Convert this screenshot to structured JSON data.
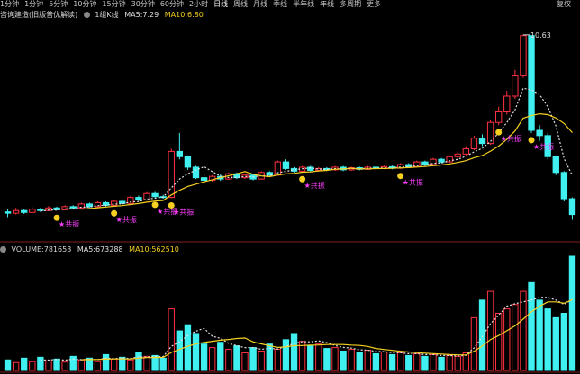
{
  "toolbar": {
    "tabs": [
      "1分钟",
      "1分钟",
      "5分钟",
      "10分钟",
      "15分钟",
      "30分钟",
      "60分钟",
      "2小时",
      "日线",
      "周线",
      "月线",
      "季线",
      "半年线",
      "年线",
      "多周期",
      "更多"
    ],
    "active_index": 8,
    "right_label": "复权"
  },
  "price_panel": {
    "title": "咨询建造(旧版普优解读)",
    "indicator": "1组K线",
    "ma5_label": "MA5:7.29",
    "ma10_label": "MA10:6.80",
    "peak_label": "10.63",
    "signal_label": "共振",
    "colors": {
      "up": "#ff3040",
      "down": "#40f0f0",
      "ma5": "#e0e0e0",
      "ma10": "#f5d020"
    }
  },
  "volume_panel": {
    "volume_label": "VOLUME:781653",
    "ma5_label": "MA5:673288",
    "ma10_label": "MA10:562510"
  },
  "chart_data": {
    "type": "candlestick",
    "price_ylim": [
      3.0,
      11.0
    ],
    "candles": [
      [
        3.9,
        3.85,
        4.0,
        3.7
      ],
      [
        3.85,
        3.95,
        4.05,
        3.8
      ],
      [
        3.95,
        3.88,
        4.0,
        3.82
      ],
      [
        3.88,
        4.0,
        4.08,
        3.85
      ],
      [
        4.0,
        3.95,
        4.05,
        3.9
      ],
      [
        3.95,
        4.05,
        4.12,
        3.92
      ],
      [
        4.05,
        3.98,
        4.1,
        3.95
      ],
      [
        3.98,
        4.1,
        4.15,
        3.96
      ],
      [
        4.1,
        4.05,
        4.15,
        4.0
      ],
      [
        4.05,
        4.2,
        4.25,
        4.02
      ],
      [
        4.2,
        4.1,
        4.25,
        4.05
      ],
      [
        4.1,
        4.25,
        4.3,
        4.08
      ],
      [
        4.25,
        4.15,
        4.3,
        4.1
      ],
      [
        4.15,
        4.3,
        4.35,
        4.12
      ],
      [
        4.3,
        4.22,
        4.36,
        4.18
      ],
      [
        4.22,
        4.45,
        4.5,
        4.2
      ],
      [
        4.45,
        4.35,
        4.52,
        4.3
      ],
      [
        4.35,
        4.6,
        4.65,
        4.32
      ],
      [
        4.6,
        4.48,
        4.66,
        4.44
      ],
      [
        4.48,
        4.45,
        4.55,
        4.4
      ],
      [
        4.45,
        6.2,
        6.3,
        4.42
      ],
      [
        6.2,
        6.0,
        6.9,
        5.9
      ],
      [
        6.0,
        5.6,
        6.05,
        5.5
      ],
      [
        5.6,
        5.2,
        5.65,
        5.15
      ],
      [
        5.2,
        5.1,
        5.3,
        5.05
      ],
      [
        5.1,
        5.25,
        5.3,
        5.05
      ],
      [
        5.25,
        5.15,
        5.32,
        5.08
      ],
      [
        5.15,
        5.35,
        5.4,
        5.12
      ],
      [
        5.35,
        5.2,
        5.4,
        5.15
      ],
      [
        5.2,
        5.3,
        5.35,
        5.15
      ],
      [
        5.3,
        5.15,
        5.35,
        5.1
      ],
      [
        5.15,
        5.4,
        5.45,
        5.12
      ],
      [
        5.4,
        5.3,
        5.45,
        5.25
      ],
      [
        5.3,
        5.8,
        5.85,
        5.28
      ],
      [
        5.8,
        5.55,
        5.9,
        5.5
      ],
      [
        5.55,
        5.45,
        5.6,
        5.4
      ],
      [
        5.45,
        5.6,
        5.65,
        5.42
      ],
      [
        5.6,
        5.48,
        5.65,
        5.44
      ],
      [
        5.48,
        5.55,
        5.6,
        5.44
      ],
      [
        5.55,
        5.5,
        5.6,
        5.45
      ],
      [
        5.5,
        5.6,
        5.65,
        5.46
      ],
      [
        5.6,
        5.5,
        5.65,
        5.45
      ],
      [
        5.5,
        5.58,
        5.62,
        5.46
      ],
      [
        5.58,
        5.52,
        5.62,
        5.48
      ],
      [
        5.52,
        5.6,
        5.65,
        5.5
      ],
      [
        5.6,
        5.55,
        5.65,
        5.5
      ],
      [
        5.55,
        5.62,
        5.66,
        5.52
      ],
      [
        5.62,
        5.56,
        5.66,
        5.52
      ],
      [
        5.56,
        5.7,
        5.75,
        5.54
      ],
      [
        5.7,
        5.62,
        5.75,
        5.58
      ],
      [
        5.62,
        5.8,
        5.85,
        5.6
      ],
      [
        5.8,
        5.7,
        5.85,
        5.65
      ],
      [
        5.7,
        5.9,
        5.95,
        5.68
      ],
      [
        5.9,
        5.8,
        5.95,
        5.75
      ],
      [
        5.8,
        6.0,
        6.05,
        5.78
      ],
      [
        6.0,
        6.1,
        6.2,
        5.95
      ],
      [
        6.1,
        6.3,
        6.4,
        6.05
      ],
      [
        6.3,
        6.7,
        6.8,
        6.25
      ],
      [
        6.7,
        6.5,
        6.85,
        6.4
      ],
      [
        6.5,
        7.3,
        7.4,
        6.45
      ],
      [
        7.3,
        7.7,
        7.9,
        7.2
      ],
      [
        7.7,
        8.3,
        8.5,
        7.6
      ],
      [
        8.3,
        9.1,
        9.3,
        8.2
      ],
      [
        9.1,
        10.6,
        10.63,
        9.0
      ],
      [
        10.6,
        7.0,
        10.6,
        6.9
      ],
      [
        7.0,
        6.8,
        7.2,
        6.6
      ],
      [
        6.8,
        6.0,
        6.9,
        5.9
      ],
      [
        6.0,
        5.4,
        6.05,
        5.3
      ],
      [
        5.4,
        4.4,
        5.45,
        4.3
      ],
      [
        4.4,
        3.8,
        4.45,
        3.6
      ]
    ],
    "volumes": [
      120,
      90,
      140,
      100,
      150,
      110,
      130,
      95,
      160,
      120,
      140,
      100,
      180,
      130,
      150,
      120,
      200,
      160,
      170,
      140,
      700,
      450,
      520,
      420,
      300,
      260,
      320,
      240,
      280,
      200,
      260,
      220,
      300,
      240,
      350,
      420,
      330,
      280,
      300,
      250,
      260,
      220,
      240,
      200,
      230,
      190,
      210,
      180,
      200,
      170,
      190,
      160,
      180,
      150,
      170,
      160,
      200,
      600,
      800,
      900,
      650,
      700,
      750,
      900,
      1000,
      800,
      700,
      600,
      650,
      1300
    ]
  }
}
